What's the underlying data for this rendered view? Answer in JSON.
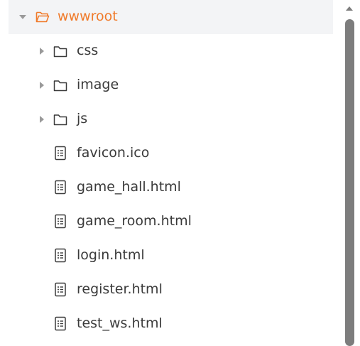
{
  "tree": {
    "root": {
      "label": "wwwroot",
      "expanded": true,
      "icon": "folder-open-icon",
      "color": "#f07a2a"
    },
    "children": [
      {
        "label": "css",
        "type": "folder",
        "icon": "folder-icon"
      },
      {
        "label": "image",
        "type": "folder",
        "icon": "folder-icon"
      },
      {
        "label": "js",
        "type": "folder",
        "icon": "folder-icon"
      },
      {
        "label": "favicon.ico",
        "type": "file",
        "icon": "file-list-icon"
      },
      {
        "label": "game_hall.html",
        "type": "file",
        "icon": "file-list-icon"
      },
      {
        "label": "game_room.html",
        "type": "file",
        "icon": "file-list-icon"
      },
      {
        "label": "login.html",
        "type": "file",
        "icon": "file-list-icon"
      },
      {
        "label": "register.html",
        "type": "file",
        "icon": "file-list-icon"
      },
      {
        "label": "test_ws.html",
        "type": "file",
        "icon": "file-list-icon"
      }
    ]
  },
  "colors": {
    "accent": "#f07a2a",
    "text": "#3a3a3a",
    "selected_bg": "#f3f4f6",
    "scrollbar": "#7d7d7d"
  }
}
